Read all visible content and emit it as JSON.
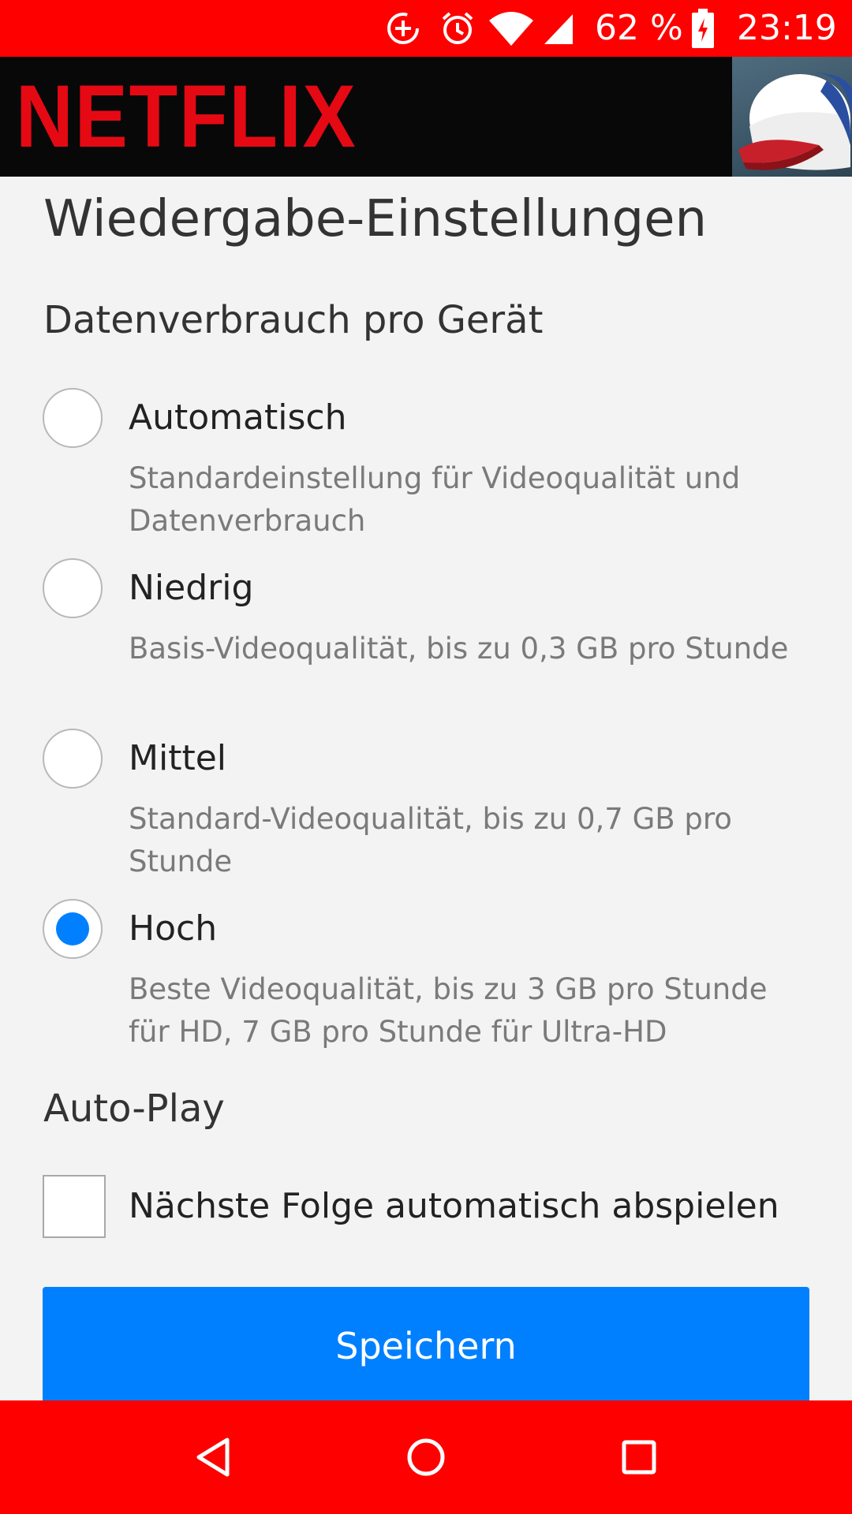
{
  "status_bar": {
    "battery_percent": "62 %",
    "time": "23:19",
    "icons": [
      "data-saver-icon",
      "alarm-icon",
      "wifi-icon",
      "signal-icon",
      "battery-charging-icon"
    ],
    "background_color": "#ff0000"
  },
  "header": {
    "logo_text": "NETFLIX",
    "logo_color": "#e50914",
    "background_color": "#080808",
    "avatar": "profile-avatar-cap-icon"
  },
  "page": {
    "title": "Wiedergabe-Einstellungen",
    "data_usage": {
      "heading": "Datenverbrauch pro Gerät",
      "selected": "Hoch",
      "options": [
        {
          "label": "Automatisch",
          "description": "Standardeinstellung für Videoqualität und Datenverbrauch"
        },
        {
          "label": "Niedrig",
          "description": "Basis-Videoqualität, bis zu 0,3 GB pro Stunde"
        },
        {
          "label": "Mittel",
          "description": "Standard-Videoqualität, bis zu 0,7 GB pro Stunde"
        },
        {
          "label": "Hoch",
          "description": "Beste Videoqualität, bis zu 3 GB pro Stunde für HD, 7 GB pro Stunde für Ultra-HD"
        }
      ]
    },
    "autoplay": {
      "heading": "Auto-Play",
      "checkbox_label": "Nächste Folge automatisch abspielen",
      "checked": false
    },
    "save_label": "Speichern",
    "accent_color": "#0080ff"
  },
  "nav_bar": {
    "buttons": [
      "back-icon",
      "home-icon",
      "recents-icon"
    ],
    "background_color": "#ff0000"
  }
}
